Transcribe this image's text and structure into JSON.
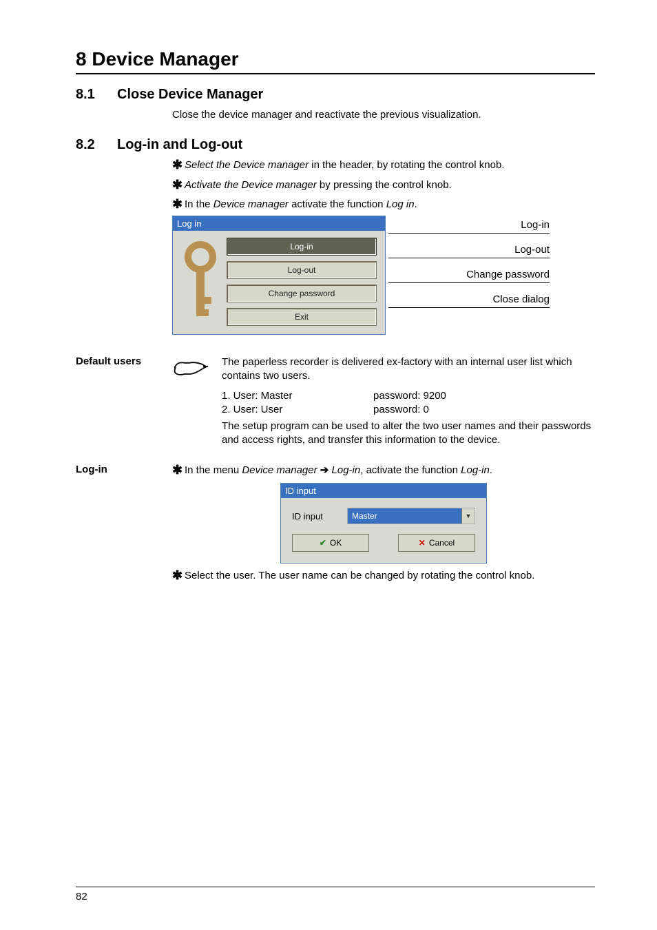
{
  "page_number": "82",
  "chapter_title": "8 Device Manager",
  "section_81": {
    "num": "8.1",
    "title": "Close Device Manager",
    "para": "Close the device manager and reactivate the previous visualization."
  },
  "section_82": {
    "num": "8.2",
    "title": "Log-in and Log-out",
    "bullets": {
      "b1_a": "Select the Device manager",
      "b1_b": " in the header, by rotating the control knob.",
      "b2_a": "Activate the Device manager",
      "b2_b": " by pressing the control knob.",
      "b3_a": "In the ",
      "b3_b": "Device manager",
      "b3_c": " activate the function ",
      "b3_d": "Log in",
      "b3_e": "."
    },
    "login_panel": {
      "header": "Log in",
      "btn_login": "Log-in",
      "btn_logout": "Log-out",
      "btn_change": "Change password",
      "btn_exit": "Exit",
      "label_login": "Log-in",
      "label_logout": "Log-out",
      "label_change": "Change password",
      "label_close": "Close dialog"
    }
  },
  "default_users": {
    "margin_label": "Default users",
    "para": "The paperless recorder is delivered ex-factory with an internal user list which contains two users.",
    "row1_a": "1. User: Master",
    "row1_b": "password: 9200",
    "row2_a": "2. User: User",
    "row2_b": "password: 0",
    "setup": "The setup program can be used to alter the two user names and their passwords and access rights, and transfer this information to the device."
  },
  "login": {
    "margin_label": "Log-in",
    "bullet_a": "In the menu ",
    "bullet_b": "Device manager",
    "bullet_c": "Log-in",
    "bullet_d": ", activate the function ",
    "bullet_e": "Log-in",
    "bullet_f": ".",
    "dialog": {
      "header": "ID input",
      "field_label": "ID input",
      "select_value": "Master",
      "ok": "OK",
      "cancel": "Cancel"
    },
    "after_a": "Select the user. The user name can be changed by rotating the control knob."
  }
}
